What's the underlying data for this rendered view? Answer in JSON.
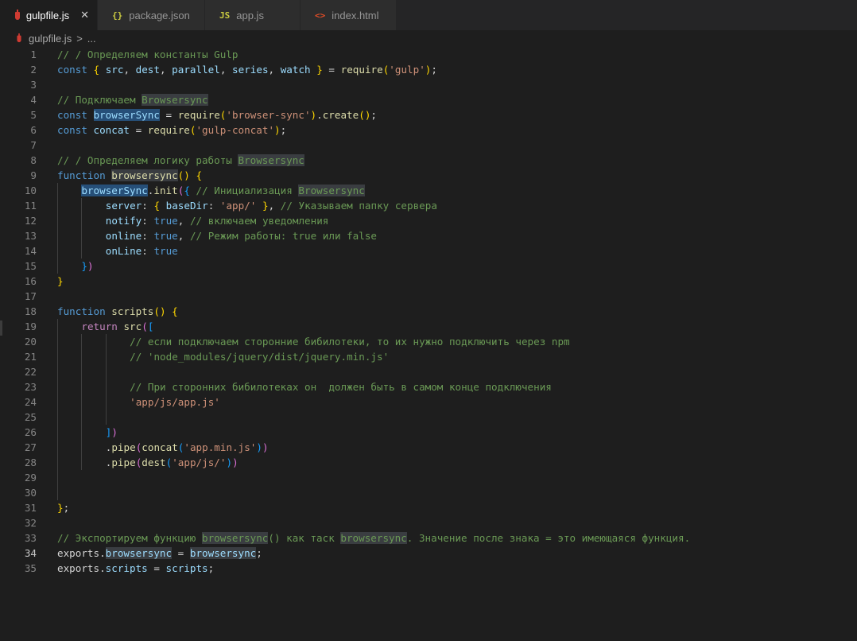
{
  "tabs": [
    {
      "icon": "gulp-icon",
      "label": "gulpfile.js",
      "active": true,
      "close": "✕"
    },
    {
      "icon": "{}",
      "label": "package.json"
    },
    {
      "icon": "JS",
      "label": "app.js"
    },
    {
      "icon": "<>",
      "label": "index.html"
    }
  ],
  "breadcrumb": {
    "file": "gulpfile.js",
    "sep": ">",
    "more": "..."
  },
  "colors": {
    "editor_bg": "#1e1e1e",
    "tab_bg": "#2d2d2d",
    "comment": "#6a9955",
    "keyword": "#569cd6",
    "string": "#ce9178",
    "variable": "#9cdcfe",
    "function": "#dcdcaa"
  },
  "current_line": 34,
  "lines": [
    {
      "n": "1",
      "code": "// / Определяем константы Gulp"
    },
    {
      "n": "2",
      "code": "const { src, dest, parallel, series, watch } = require('gulp');"
    },
    {
      "n": "3",
      "code": ""
    },
    {
      "n": "4",
      "code": "// Подключаем Browsersync"
    },
    {
      "n": "5",
      "code": "const browserSync = require('browser-sync').create();"
    },
    {
      "n": "6",
      "code": "const concat = require('gulp-concat');"
    },
    {
      "n": "7",
      "code": ""
    },
    {
      "n": "8",
      "code": "// / Определяем логику работы Browsersync"
    },
    {
      "n": "9",
      "code": "function browsersync() {"
    },
    {
      "n": "10",
      "code": "    browserSync.init({ // Инициализация Browsersync"
    },
    {
      "n": "11",
      "code": "        server: { baseDir: 'app/' }, // Указываем папку сервера"
    },
    {
      "n": "12",
      "code": "        notify: true, // включаем уведомления"
    },
    {
      "n": "13",
      "code": "        online: true, // Режим работы: true или false"
    },
    {
      "n": "14",
      "code": "        onLine: true"
    },
    {
      "n": "15",
      "code": "    })"
    },
    {
      "n": "16",
      "code": "}"
    },
    {
      "n": "17",
      "code": ""
    },
    {
      "n": "18",
      "code": "function scripts() {"
    },
    {
      "n": "19",
      "code": "    return src(["
    },
    {
      "n": "20",
      "code": "            // если подключаем сторонние бибилотеки, то их нужно подключить через npm"
    },
    {
      "n": "21",
      "code": "            // 'node_modules/jquery/dist/jquery.min.js'"
    },
    {
      "n": "22",
      "code": ""
    },
    {
      "n": "23",
      "code": "            // При сторонних бибилотеках он  должен быть в самом конце подключения"
    },
    {
      "n": "24",
      "code": "            'app/js/app.js'"
    },
    {
      "n": "25",
      "code": ""
    },
    {
      "n": "26",
      "code": "        ])"
    },
    {
      "n": "27",
      "code": "        .pipe(concat('app.min.js'))"
    },
    {
      "n": "28",
      "code": "        .pipe(dest('app/js/'))"
    },
    {
      "n": "29",
      "code": ""
    },
    {
      "n": "30",
      "code": ""
    },
    {
      "n": "31",
      "code": "};"
    },
    {
      "n": "32",
      "code": ""
    },
    {
      "n": "33",
      "code": "// Экспортируем функцию browsersync() как таск browsersync. Значение после знака = это имеющаяся функция."
    },
    {
      "n": "34",
      "code": "exports.browsersync = browsersync;"
    },
    {
      "n": "35",
      "code": "exports.scripts = scripts;"
    }
  ]
}
